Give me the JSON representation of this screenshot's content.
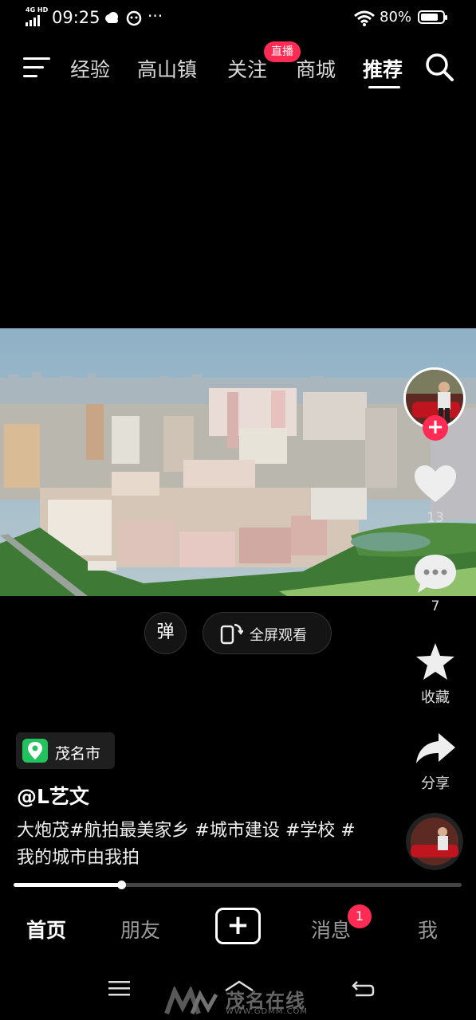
{
  "status_bar": {
    "network": "4G HD",
    "time": "09:25",
    "battery": "80%",
    "battery_level": 0.8,
    "icons": [
      "weather-cloud-icon",
      "message-bubble-icon",
      "more-dots-icon",
      "wifi-icon",
      "battery-icon"
    ]
  },
  "top_nav": {
    "tabs": [
      {
        "label": "经验"
      },
      {
        "label": "高山镇"
      },
      {
        "label": "关注"
      },
      {
        "label": "商城"
      },
      {
        "label": "推荐"
      }
    ],
    "active_tab": "推荐",
    "live_badge": "直播"
  },
  "player": {
    "danmu_label": "弹",
    "fullscreen_label": "全屏观看"
  },
  "rail": {
    "likes": "13",
    "comments": "7",
    "favorite_label": "收藏",
    "share_label": "分享"
  },
  "post": {
    "location": "茂名市",
    "author": "@L艺文",
    "caption": "大炮茂#航拍最美家乡 #城市建设 #学校 #我的城市由我拍",
    "progress": 0.24
  },
  "bottom_nav": {
    "home": "首页",
    "friends": "朋友",
    "messages": "消息",
    "messages_badge": "1",
    "me": "我"
  },
  "watermark": {
    "brand": "茂名在线",
    "url": "WWW.GDMM.COM"
  },
  "colors": {
    "accent": "#fe2c55",
    "background": "#000000",
    "location_pin": "#22c35e"
  }
}
